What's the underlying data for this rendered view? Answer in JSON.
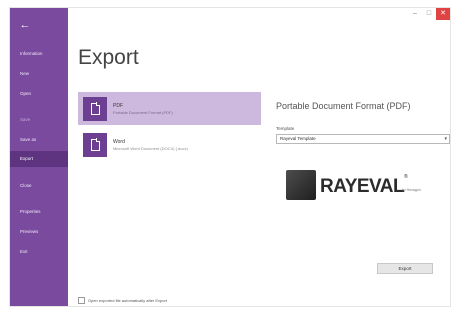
{
  "window": {
    "controls": {
      "minimize": "–",
      "maximize": "□",
      "close": "✕"
    }
  },
  "sidebar": {
    "back_icon": "←",
    "items": [
      {
        "label": "Information",
        "active": false
      },
      {
        "label": "New",
        "active": false
      },
      {
        "label": "Open",
        "active": false
      },
      {
        "label": "Save",
        "active": false,
        "dim": true
      },
      {
        "label": "Save as",
        "active": false
      },
      {
        "label": "Export",
        "active": true
      },
      {
        "label": "Close",
        "active": false
      },
      {
        "label": "Properties",
        "active": false
      },
      {
        "label": "Previews",
        "active": false
      },
      {
        "label": "Exit",
        "active": false
      }
    ]
  },
  "main": {
    "title": "Export",
    "formats": [
      {
        "name": "PDF",
        "description": "Portable Document Format (PDF)",
        "selected": true,
        "icon": "document-icon"
      },
      {
        "name": "Word",
        "description": "Microsoft Word Document (DOCX) (.docx)",
        "selected": false,
        "icon": "document-icon"
      }
    ]
  },
  "detail": {
    "title": "Portable Document Format (PDF)",
    "template_label": "Template",
    "template_value": "Rayeval Template",
    "logo": {
      "text": "RAYEVAL",
      "tm": "®",
      "sub": "by Hexagon"
    },
    "export_button": "Export"
  },
  "footer": {
    "open_checkbox_label": "Open exported file automatically after Export",
    "checked": false
  },
  "colors": {
    "sidebar": "#7a4a9e",
    "sidebar_active": "#5e3480",
    "selected_item": "#cdb9dd",
    "icon_bg": "#6c3f92",
    "close_button": "#e04343"
  }
}
